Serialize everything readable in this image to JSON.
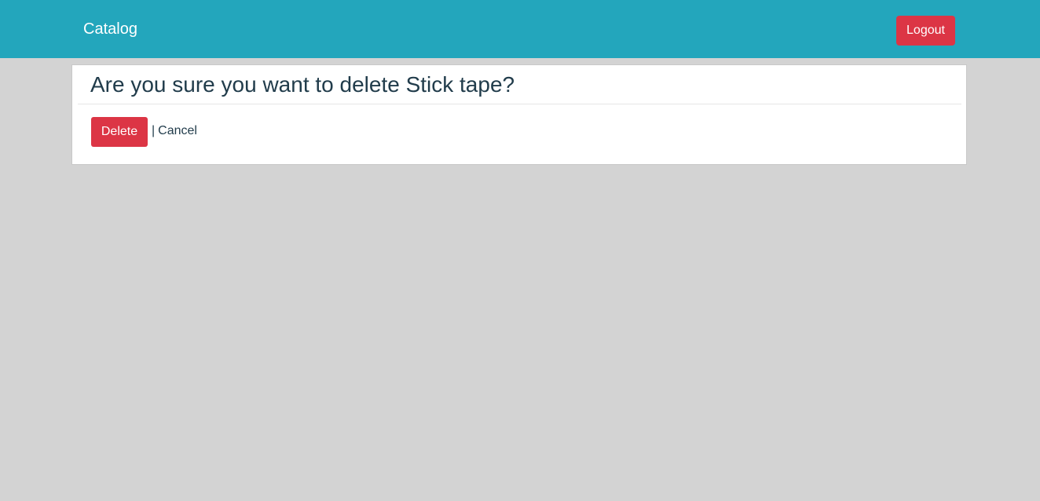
{
  "navbar": {
    "brand": "Catalog",
    "logout_label": "Logout"
  },
  "card": {
    "title": "Are you sure you want to delete Stick tape?",
    "delete_label": "Delete",
    "separator": "|",
    "cancel_label": "Cancel"
  },
  "colors": {
    "navbar_bg": "#23a6bc",
    "danger": "#dc3545",
    "page_bg": "#d3d3d3",
    "text": "#213c4b"
  }
}
